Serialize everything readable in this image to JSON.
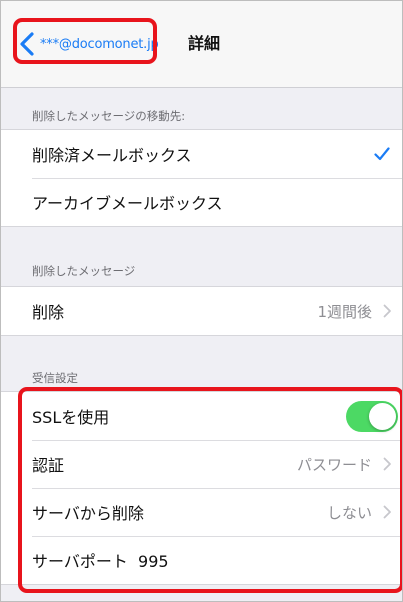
{
  "nav": {
    "back_label": "***@docomonet.jp",
    "title": "詳細"
  },
  "sections": {
    "deleted_destination": {
      "header": "削除したメッセージの移動先:",
      "rows": [
        {
          "label": "削除済メールボックス",
          "selected": true
        },
        {
          "label": "アーカイブメールボックス",
          "selected": false
        }
      ]
    },
    "deleted_messages": {
      "header": "削除したメッセージ",
      "rows": [
        {
          "label": "削除",
          "value": "1週間後"
        }
      ]
    },
    "incoming": {
      "header": "受信設定",
      "ssl": {
        "label": "SSLを使用",
        "enabled": true
      },
      "auth": {
        "label": "認証",
        "value": "パスワード"
      },
      "delete_from_server": {
        "label": "サーバから削除",
        "value": "しない"
      },
      "server_port": {
        "label": "サーバポート",
        "value": "995"
      }
    }
  },
  "colors": {
    "accent": "#1a7cf5",
    "toggle_on": "#4cd964",
    "highlight": "#e8141c"
  }
}
